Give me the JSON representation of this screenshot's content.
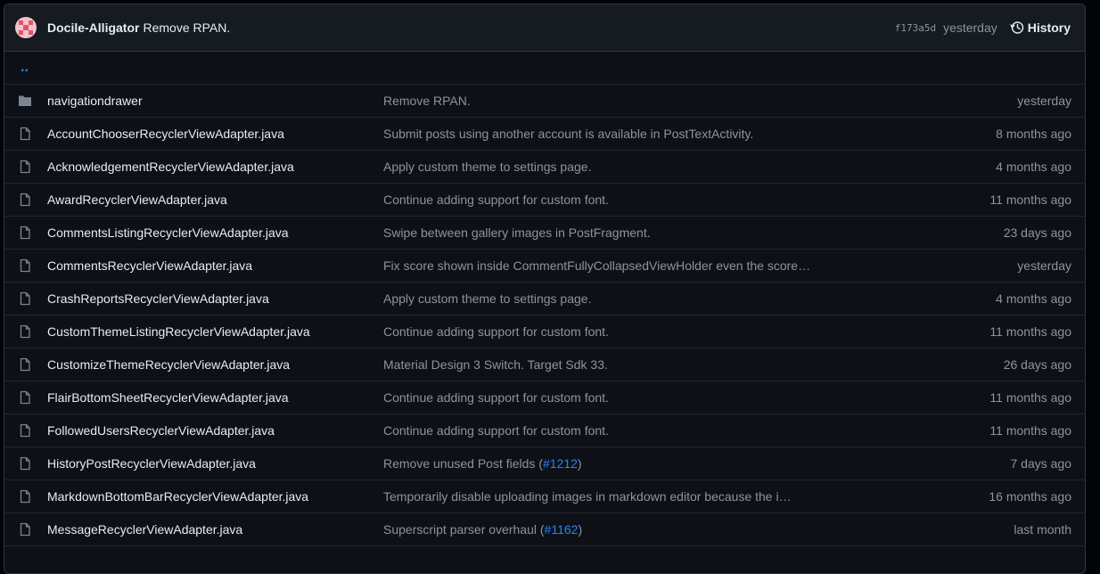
{
  "header": {
    "author": "Docile-Alligator",
    "message": "Remove RPAN.",
    "sha": "f173a5d",
    "when": "yesterday",
    "history_label": "History"
  },
  "parent_link": "..",
  "files": [
    {
      "type": "folder-icon",
      "name": "navigationdrawer",
      "message": "Remove RPAN.",
      "age": "yesterday"
    },
    {
      "type": "file-icon",
      "name": "AccountChooserRecyclerViewAdapter.java",
      "message": "Submit posts using another account is available in PostTextActivity.",
      "age": "8 months ago"
    },
    {
      "type": "file-icon",
      "name": "AcknowledgementRecyclerViewAdapter.java",
      "message": "Apply custom theme to settings page.",
      "age": "4 months ago"
    },
    {
      "type": "file-icon",
      "name": "AwardRecyclerViewAdapter.java",
      "message": "Continue adding support for custom font.",
      "age": "11 months ago"
    },
    {
      "type": "file-icon",
      "name": "CommentsListingRecyclerViewAdapter.java",
      "message": "Swipe between gallery images in PostFragment.",
      "age": "23 days ago"
    },
    {
      "type": "file-icon",
      "name": "CommentsRecyclerViewAdapter.java",
      "message": "Fix score shown inside CommentFullyCollapsedViewHolder even the score…",
      "age": "yesterday"
    },
    {
      "type": "file-icon",
      "name": "CrashReportsRecyclerViewAdapter.java",
      "message": "Apply custom theme to settings page.",
      "age": "4 months ago"
    },
    {
      "type": "file-icon",
      "name": "CustomThemeListingRecyclerViewAdapter.java",
      "message": "Continue adding support for custom font.",
      "age": "11 months ago"
    },
    {
      "type": "file-icon",
      "name": "CustomizeThemeRecyclerViewAdapter.java",
      "message": "Material Design 3 Switch. Target Sdk 33.",
      "age": "26 days ago"
    },
    {
      "type": "file-icon",
      "name": "FlairBottomSheetRecyclerViewAdapter.java",
      "message": "Continue adding support for custom font.",
      "age": "11 months ago"
    },
    {
      "type": "file-icon",
      "name": "FollowedUsersRecyclerViewAdapter.java",
      "message": "Continue adding support for custom font.",
      "age": "11 months ago"
    },
    {
      "type": "file-icon",
      "name": "HistoryPostRecyclerViewAdapter.java",
      "message": "Remove unused Post fields (",
      "link": "#1212",
      "message_end": ")",
      "age": "7 days ago"
    },
    {
      "type": "file-icon",
      "name": "MarkdownBottomBarRecyclerViewAdapter.java",
      "message": "Temporarily disable uploading images in markdown editor because the i…",
      "age": "16 months ago"
    },
    {
      "type": "file-icon",
      "name": "MessageRecyclerViewAdapter.java",
      "message": "Superscript parser overhaul (",
      "link": "#1162",
      "message_end": ")",
      "age": "last month"
    }
  ]
}
